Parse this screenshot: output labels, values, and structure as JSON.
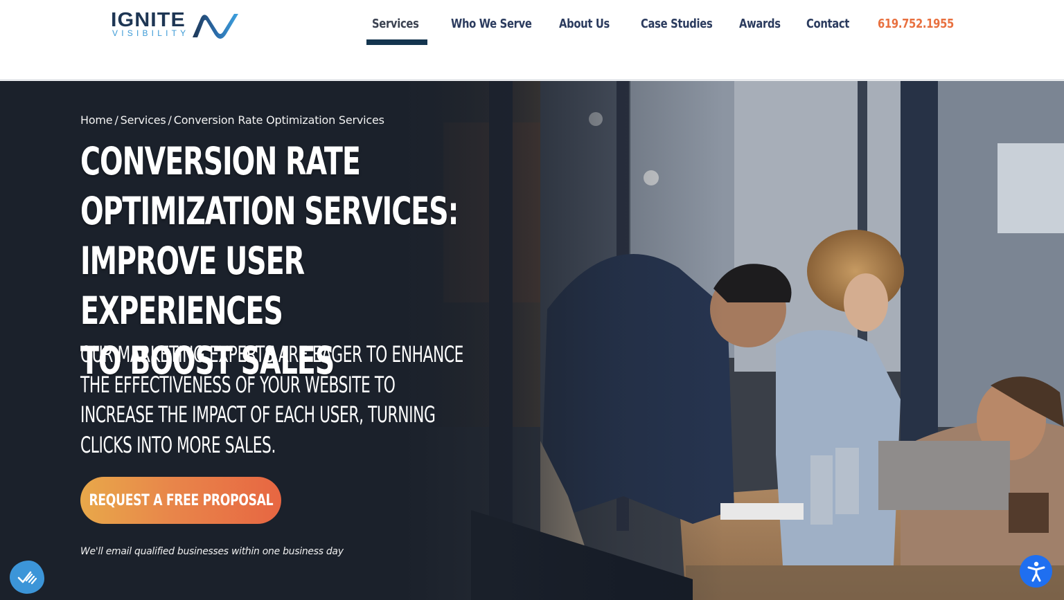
{
  "header": {
    "logo": {
      "word": "IGNITE",
      "sub": "VISIBILITY",
      "brand_dark": "#1e3654",
      "brand_light": "#3b9ad6"
    },
    "nav": [
      {
        "label": "Services",
        "active": true
      },
      {
        "label": "Who We Serve",
        "active": false
      },
      {
        "label": "About Us",
        "active": false
      },
      {
        "label": "Case Studies",
        "active": false
      },
      {
        "label": "Awards",
        "active": false
      },
      {
        "label": "Contact",
        "active": false
      }
    ],
    "phone": "619.752.1955",
    "accent_color": "#e8703f",
    "active_underline_color": "#14354f"
  },
  "hero": {
    "breadcrumb": [
      {
        "label": "Home"
      },
      {
        "label": "Services"
      },
      {
        "label": "Conversion Rate Optimization Services"
      }
    ],
    "breadcrumb_separator": "/",
    "title_lines": [
      "CONVERSION RATE",
      "OPTIMIZATION SERVICES:",
      "IMPROVE USER EXPERIENCES",
      "TO BOOST SALES"
    ],
    "subtitle_lines": [
      "OUR MARKETING EXPERTS ARE EAGER TO ENHANCE",
      "THE EFFECTIVENESS OF YOUR WEBSITE TO",
      "INCREASE THE IMPACT OF EACH USER, TURNING",
      "CLICKS INTO MORE SALES."
    ],
    "cta_label": "REQUEST A FREE PROPOSAL",
    "cta_note": "We'll email qualified businesses within one business day",
    "image_description": "Three coworkers discussing at an office table with a laptop and glasses of water"
  },
  "widgets": {
    "chat_icon": "checkmark-chat-icon",
    "accessibility_icon": "accessibility-person-icon"
  }
}
